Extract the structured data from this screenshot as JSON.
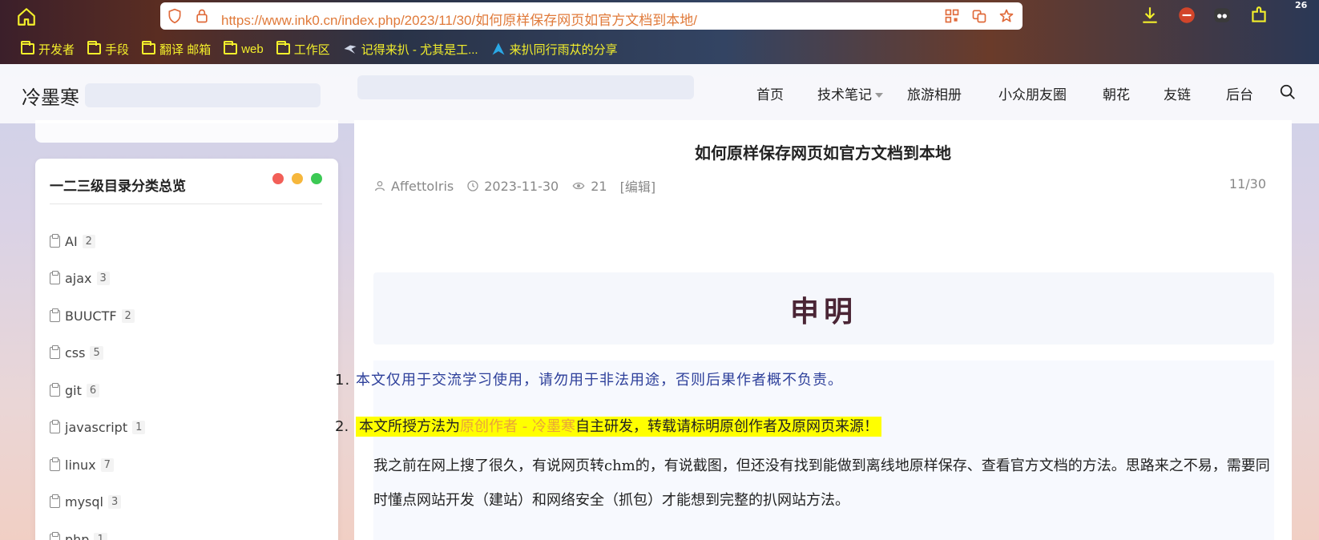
{
  "browser": {
    "url": "https://www.ink0.cn/index.php/2023/11/30/如何原样保存网页如官方文档到本地/",
    "extension_badge": "26",
    "bookmarks": [
      {
        "label": "开发者",
        "icon": "folder-icon"
      },
      {
        "label": "手段",
        "icon": "folder-icon"
      },
      {
        "label": "翻译 邮箱",
        "icon": "folder-icon"
      },
      {
        "label": "web",
        "icon": "folder-icon"
      },
      {
        "label": "工作区",
        "icon": "folder-icon"
      },
      {
        "label": "记得来扒 - 尤其是工...",
        "icon": "bird-icon"
      },
      {
        "label": "来扒同行雨苁的分享",
        "icon": "arrow-logo-icon"
      }
    ]
  },
  "site": {
    "logo": "冷墨寒",
    "nav": [
      "首页",
      "技术笔记",
      "旅游相册",
      "小众朋友圈",
      "朝花",
      "友链",
      "后台"
    ]
  },
  "sidebar": {
    "card_title": "一二三级目录分类总览",
    "dot_colors": [
      "#f25f58",
      "#f6b73c",
      "#3cc954"
    ],
    "categories": [
      {
        "name": "AI",
        "count": "2"
      },
      {
        "name": "ajax",
        "count": "3"
      },
      {
        "name": "BUUCTF",
        "count": "2"
      },
      {
        "name": "css",
        "count": "5"
      },
      {
        "name": "git",
        "count": "6"
      },
      {
        "name": "javascript",
        "count": "1"
      },
      {
        "name": "linux",
        "count": "7"
      },
      {
        "name": "mysql",
        "count": "3"
      },
      {
        "name": "php",
        "count": "1"
      }
    ]
  },
  "article": {
    "title": "如何原样保存网页如官方文档到本地",
    "author": "AffettoIris",
    "date": "2023-11-30",
    "views": "21",
    "edit": "[编辑]",
    "date_short": "11/30",
    "notice_title": "申明",
    "list": [
      {
        "num": "1.",
        "text": "本文仅用于交流学习使用，请勿用于非法用途，否则后果作者概不负责。"
      },
      {
        "num": "2.",
        "pre": "本文所授方法为",
        "highlight": "原创作者 - 冷墨寒",
        "post": "自主研发，转载请标明原创作者及原网页来源！"
      }
    ],
    "paragraph": "我之前在网上搜了很久，有说网页转chm的，有说截图，但还没有找到能做到离线地原样保存、查看官方文档的方法。思路来之不易，需要同时懂点网站开发（建站）和网络安全（抓包）才能想到完整的扒网站方法。"
  }
}
